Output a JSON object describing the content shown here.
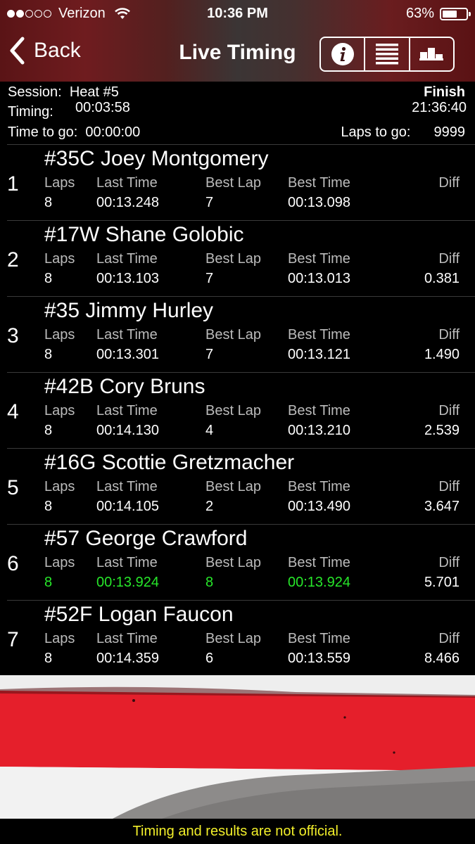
{
  "status_bar": {
    "signal_dots_filled": 2,
    "signal_dots_total": 5,
    "carrier": "Verizon",
    "wifi_icon": "wifi-icon",
    "time": "10:36 PM",
    "battery_percent": "63%",
    "battery_level": 0.63
  },
  "nav": {
    "back_label": "Back",
    "title": "Live Timing",
    "buttons": [
      "info-icon",
      "list-icon",
      "podium-icon"
    ]
  },
  "session": {
    "session_label": "Session:",
    "session_value": "Heat #5",
    "status": "Finish",
    "timing_label": "Timing:",
    "timing_value": "00:03:58",
    "clock": "21:36:40",
    "time_to_go_label": "Time to go:",
    "time_to_go_value": "00:00:00",
    "laps_to_go_label": "Laps to go:",
    "laps_to_go_value": "9999"
  },
  "columns": {
    "laps": "Laps",
    "last_time": "Last Time",
    "best_lap": "Best Lap",
    "best_time": "Best Time",
    "diff": "Diff"
  },
  "results": [
    {
      "pos": "1",
      "driver": "#35C Joey Montgomery",
      "laps": "8",
      "last_time": "00:13.248",
      "best_lap": "7",
      "best_time": "00:13.098",
      "diff": "",
      "highlight": false
    },
    {
      "pos": "2",
      "driver": "#17W Shane Golobic",
      "laps": "8",
      "last_time": "00:13.103",
      "best_lap": "7",
      "best_time": "00:13.013",
      "diff": "0.381",
      "highlight": false
    },
    {
      "pos": "3",
      "driver": "#35 Jimmy Hurley",
      "laps": "8",
      "last_time": "00:13.301",
      "best_lap": "7",
      "best_time": "00:13.121",
      "diff": "1.490",
      "highlight": false
    },
    {
      "pos": "4",
      "driver": "#42B Cory Bruns",
      "laps": "8",
      "last_time": "00:14.130",
      "best_lap": "4",
      "best_time": "00:13.210",
      "diff": "2.539",
      "highlight": false
    },
    {
      "pos": "5",
      "driver": "#16G Scottie Gretzmacher",
      "laps": "8",
      "last_time": "00:14.105",
      "best_lap": "2",
      "best_time": "00:13.490",
      "diff": "3.647",
      "highlight": false
    },
    {
      "pos": "6",
      "driver": "#57 George Crawford",
      "laps": "8",
      "last_time": "00:13.924",
      "best_lap": "8",
      "best_time": "00:13.924",
      "diff": "5.701",
      "highlight": true
    },
    {
      "pos": "7",
      "driver": "#52F Logan Faucon",
      "laps": "8",
      "last_time": "00:14.359",
      "best_lap": "6",
      "best_time": "00:13.559",
      "diff": "8.466",
      "highlight": false
    }
  ],
  "colors": {
    "highlight_green": "#27e62a",
    "footer_text": "#f2ef2a",
    "curb_red": "#e51f2b"
  },
  "footer": {
    "notice": "Timing and results are not official."
  }
}
